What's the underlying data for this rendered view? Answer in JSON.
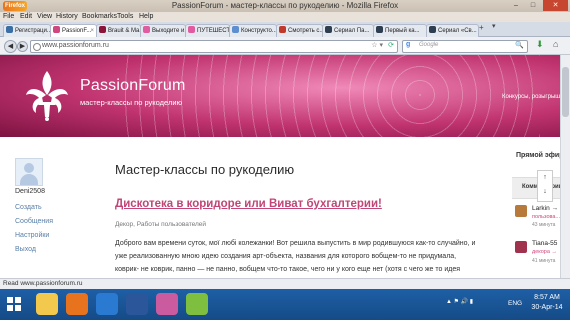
{
  "window": {
    "app_badge": "Firefox",
    "title": "PassionForum - мастер-классы по рукоделию - Mozilla Firefox",
    "controls": [
      "–",
      "□",
      "✕"
    ]
  },
  "menu": [
    "File",
    "Edit",
    "View",
    "History",
    "Bookmarks",
    "Tools",
    "Help"
  ],
  "tabs": [
    {
      "label": "Регистраци...",
      "icon_color": "#3a6ea5",
      "active": false
    },
    {
      "label": "PassionF...",
      "icon_color": "#d0467e",
      "active": true
    },
    {
      "label": "Brauit & Ma...",
      "icon_color": "#8a1538",
      "active": false
    },
    {
      "label": "Выходите и...",
      "icon_color": "#e05ba0",
      "active": false
    },
    {
      "label": "ПУТЕШЕСТ...",
      "icon_color": "#e05ba0",
      "active": false
    },
    {
      "label": "Конструкто...",
      "icon_color": "#5b8fd0",
      "active": false
    },
    {
      "label": "Смотреть с...",
      "icon_color": "#c0392b",
      "active": false
    },
    {
      "label": "Сериал Па...",
      "icon_color": "#2c3e50",
      "active": false
    },
    {
      "label": "Первый ка...",
      "icon_color": "#2c3e50",
      "active": false
    },
    {
      "label": "Сериал «Св...",
      "icon_color": "#2c3e50",
      "active": false
    }
  ],
  "tab_new": "+",
  "tab_arrows": "▾",
  "nav": {
    "back": "◀",
    "forward": "▶",
    "url": "www.passionforum.ru",
    "search_engine": "g",
    "search_placeholder": "Google",
    "search_icon": "🔍",
    "reload_icon": "⟳",
    "star_icon": "☆ ▾",
    "download_icon": "⬇",
    "home_icon": "⌂"
  },
  "site": {
    "brand": "PassionForum",
    "tagline": "мастер-классы по рукоделию",
    "menu_right": "Конкурсы, розыгрыш"
  },
  "sidebar": {
    "username": "Deni2508",
    "links": [
      "Создать",
      "Сообщения",
      "Настройки",
      "Выход"
    ]
  },
  "post": {
    "page_title": "Мастер-классы по рукоделию",
    "heading": "Дискотека в коридоре или Виват бухгалтерии!",
    "categories": "Декор, Работы пользователей",
    "lines": [
      "Доброго вам времени суток, мої любі колежанки! Вот решила выпустить в мир родившуюся как-то случайно, и",
      "уже реализованную мною идею создания арт-объекта, названия для которого вобщем-то не придумала,",
      "коврик- не коврик, панно — не панно, вобщем что-то такое, чего ни у кого еще нет (хотя с чего же то идея"
    ]
  },
  "right_column": {
    "title": "Прямой эфир",
    "tab": "Комментарии",
    "scroll_up": "↑",
    "scroll_down": "↓",
    "items": [
      {
        "name": "Larkin →",
        "sub": "пользова...",
        "time": "43 минута",
        "thumb_color": "#b77a3a"
      },
      {
        "name": "Tiana-55 →",
        "sub": "декора →",
        "time": "41 минута",
        "thumb_color": "#a0324e"
      }
    ]
  },
  "status": "Read www.passionforum.ru",
  "taskbar": {
    "apps": [
      {
        "name": "explorer",
        "color": "#f2c94c"
      },
      {
        "name": "firefox",
        "color": "#e8731e"
      },
      {
        "name": "media",
        "color": "#2a7ad1"
      },
      {
        "name": "word",
        "color": "#2b579a"
      },
      {
        "name": "paint",
        "color": "#c95b9e"
      },
      {
        "name": "tools",
        "color": "#7fbf3f"
      }
    ],
    "tray_icons": "▲ ⚑ 🔊 ▮",
    "lang": "ENG",
    "time": "8:57 AM",
    "date": "30-Apr-14"
  }
}
